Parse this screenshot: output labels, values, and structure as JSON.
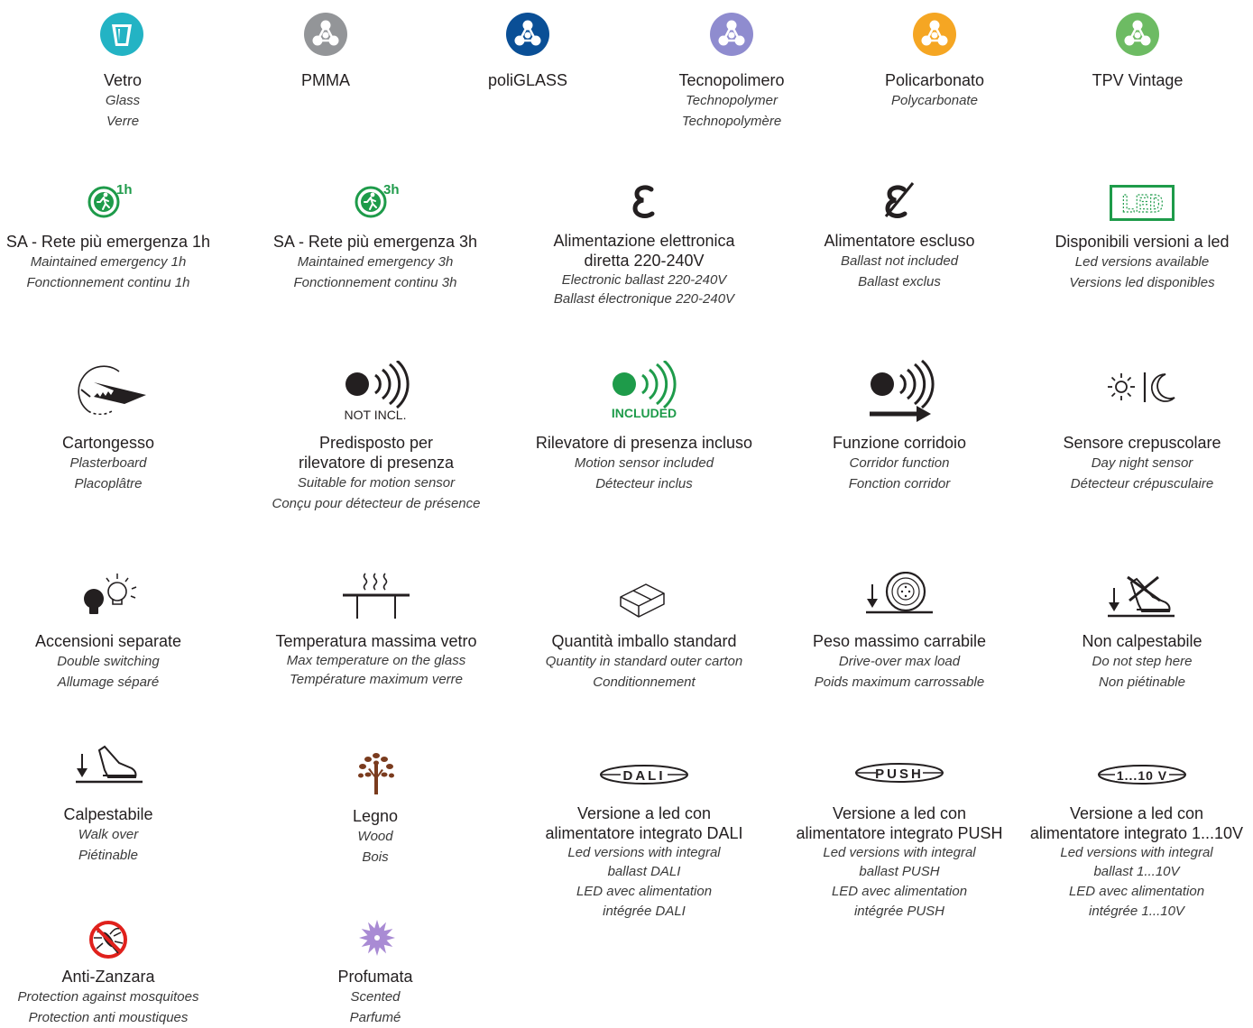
{
  "row1": [
    {
      "title": "Vetro",
      "en": "Glass",
      "fr": "Verre",
      "color": "#23b3c4",
      "icon": "glass-cup-icon"
    },
    {
      "title": "PMMA",
      "color": "#939598",
      "icon": "pmma-material-icon"
    },
    {
      "title": "poliGLASS",
      "color": "#0a4f96",
      "icon": "poliglass-material-icon"
    },
    {
      "title": "Tecnopolimero",
      "en": "Technopolymer",
      "fr": "Technopolymère",
      "color": "#8f8ccf",
      "icon": "technopolymer-material-icon"
    },
    {
      "title": "Policarbonato",
      "en": "Polycarbonate",
      "color": "#f5a623",
      "icon": "polycarbonate-material-icon"
    },
    {
      "title": "TPV Vintage",
      "color": "#6dbb63",
      "icon": "tpv-vintage-material-icon"
    }
  ],
  "row2": [
    {
      "title": "SA - Rete più emergenza 1h",
      "en": "Maintained  emergency 1h",
      "fr": "Fonctionnement continu 1h",
      "badge": "1h",
      "icon": "emergency-exit-1h-icon"
    },
    {
      "title": "SA - Rete più emergenza 3h",
      "en": "Maintained emergency 3h",
      "fr": "Fonctionnement continu 3h",
      "badge": "3h",
      "icon": "emergency-exit-3h-icon"
    },
    {
      "title": "Alimentazione elettronica",
      "title2": "diretta  220-240V",
      "en": "Electronic ballast 220-240V",
      "fr": "Ballast électronique 220-240V",
      "icon": "electronic-ballast-icon"
    },
    {
      "title": "Alimentatore escluso",
      "en": "Ballast not included",
      "fr": "Ballast exclus",
      "icon": "ballast-excluded-icon"
    },
    {
      "title": "Disponibili versioni a led",
      "en": "Led versions available",
      "fr": "Versions led disponibles",
      "led_label": "LED",
      "led_color": "#1e9b4a",
      "icon": "led-available-icon"
    }
  ],
  "row3": [
    {
      "title": "Cartongesso",
      "en": "Plasterboard",
      "fr": "Placoplâtre",
      "icon": "plasterboard-saw-icon"
    },
    {
      "title": "Predisposto per",
      "title2": "rilevatore di presenza",
      "en": "Suitable for motion sensor",
      "fr": "Conçu pour détecteur de présence",
      "badge": "NOT INCL.",
      "icon": "motion-sensor-not-included-icon"
    },
    {
      "title": "Rilevatore di presenza incluso",
      "en": "Motion sensor included",
      "fr": "Détecteur inclus",
      "badge": "INCLUDED",
      "color": "#1e9b4a",
      "icon": "motion-sensor-included-icon"
    },
    {
      "title": "Funzione corridoio",
      "en": "Corridor function",
      "fr": "Fonction corridor",
      "icon": "corridor-function-icon"
    },
    {
      "title": "Sensore crepuscolare",
      "en": "Day night sensor",
      "fr": "Détecteur crépusculaire",
      "icon": "day-night-sensor-icon"
    }
  ],
  "row4": [
    {
      "title": "Accensioni separate",
      "en": "Double switching",
      "fr": "Allumage séparé",
      "icon": "double-switching-bulbs-icon"
    },
    {
      "title": "Temperatura massima vetro",
      "en": "Max temperature on the glass",
      "fr": "Température maximum verre",
      "icon": "max-glass-temperature-icon"
    },
    {
      "title": "Quantità imballo standard",
      "en": "Quantity in standard  outer carton",
      "fr": "Conditionnement",
      "icon": "carton-box-icon"
    },
    {
      "title": "Peso massimo carrabile",
      "en": "Drive-over max load",
      "fr": "Poids maximum carrossable",
      "icon": "drive-over-wheel-icon"
    },
    {
      "title": "Non calpestabile",
      "en": "Do not step here",
      "fr": "Non piétinable",
      "icon": "no-step-shoe-icon"
    }
  ],
  "row5": [
    {
      "title": "Calpestabile",
      "en": "Walk over",
      "fr": "Piétinable",
      "icon": "walk-over-shoe-icon"
    },
    {
      "title": "Legno",
      "en": "Wood",
      "fr": "Bois",
      "color": "#7a3b1e",
      "icon": "wood-tree-icon"
    },
    {
      "title": "Versione a led con",
      "title2": "alimentatore integrato DALI",
      "en": "Led versions with integral",
      "en2": "ballast DALI",
      "fr": "LED avec alimentation",
      "fr2": "intégrée DALI",
      "badge": "DALI",
      "icon": "dali-badge-icon"
    },
    {
      "title": "Versione a led con",
      "title2": "alimentatore integrato PUSH",
      "en": "Led versions with integral",
      "en2": "ballast PUSH",
      "fr": "LED avec alimentation",
      "fr2": "intégrée PUSH",
      "badge": "PUSH",
      "icon": "push-badge-icon"
    },
    {
      "title": "Versione a led con",
      "title2": "alimentatore integrato 1...10V",
      "en": "Led versions with integral",
      "en2": "ballast 1...10V",
      "fr": "LED avec alimentation",
      "fr2": "intégrée 1...10V",
      "badge": "1...10 V",
      "icon": "1-10v-badge-icon"
    }
  ],
  "row6": [
    {
      "title": "Anti-Zanzara",
      "en": "Protection against mosquitoes",
      "fr": "Protection anti moustiques",
      "color": "#e0211c",
      "icon": "anti-mosquito-icon"
    },
    {
      "title": "Profumata",
      "en": "Scented",
      "fr": "Parfumé",
      "color": "#a98bd4",
      "icon": "scented-flower-icon"
    }
  ]
}
